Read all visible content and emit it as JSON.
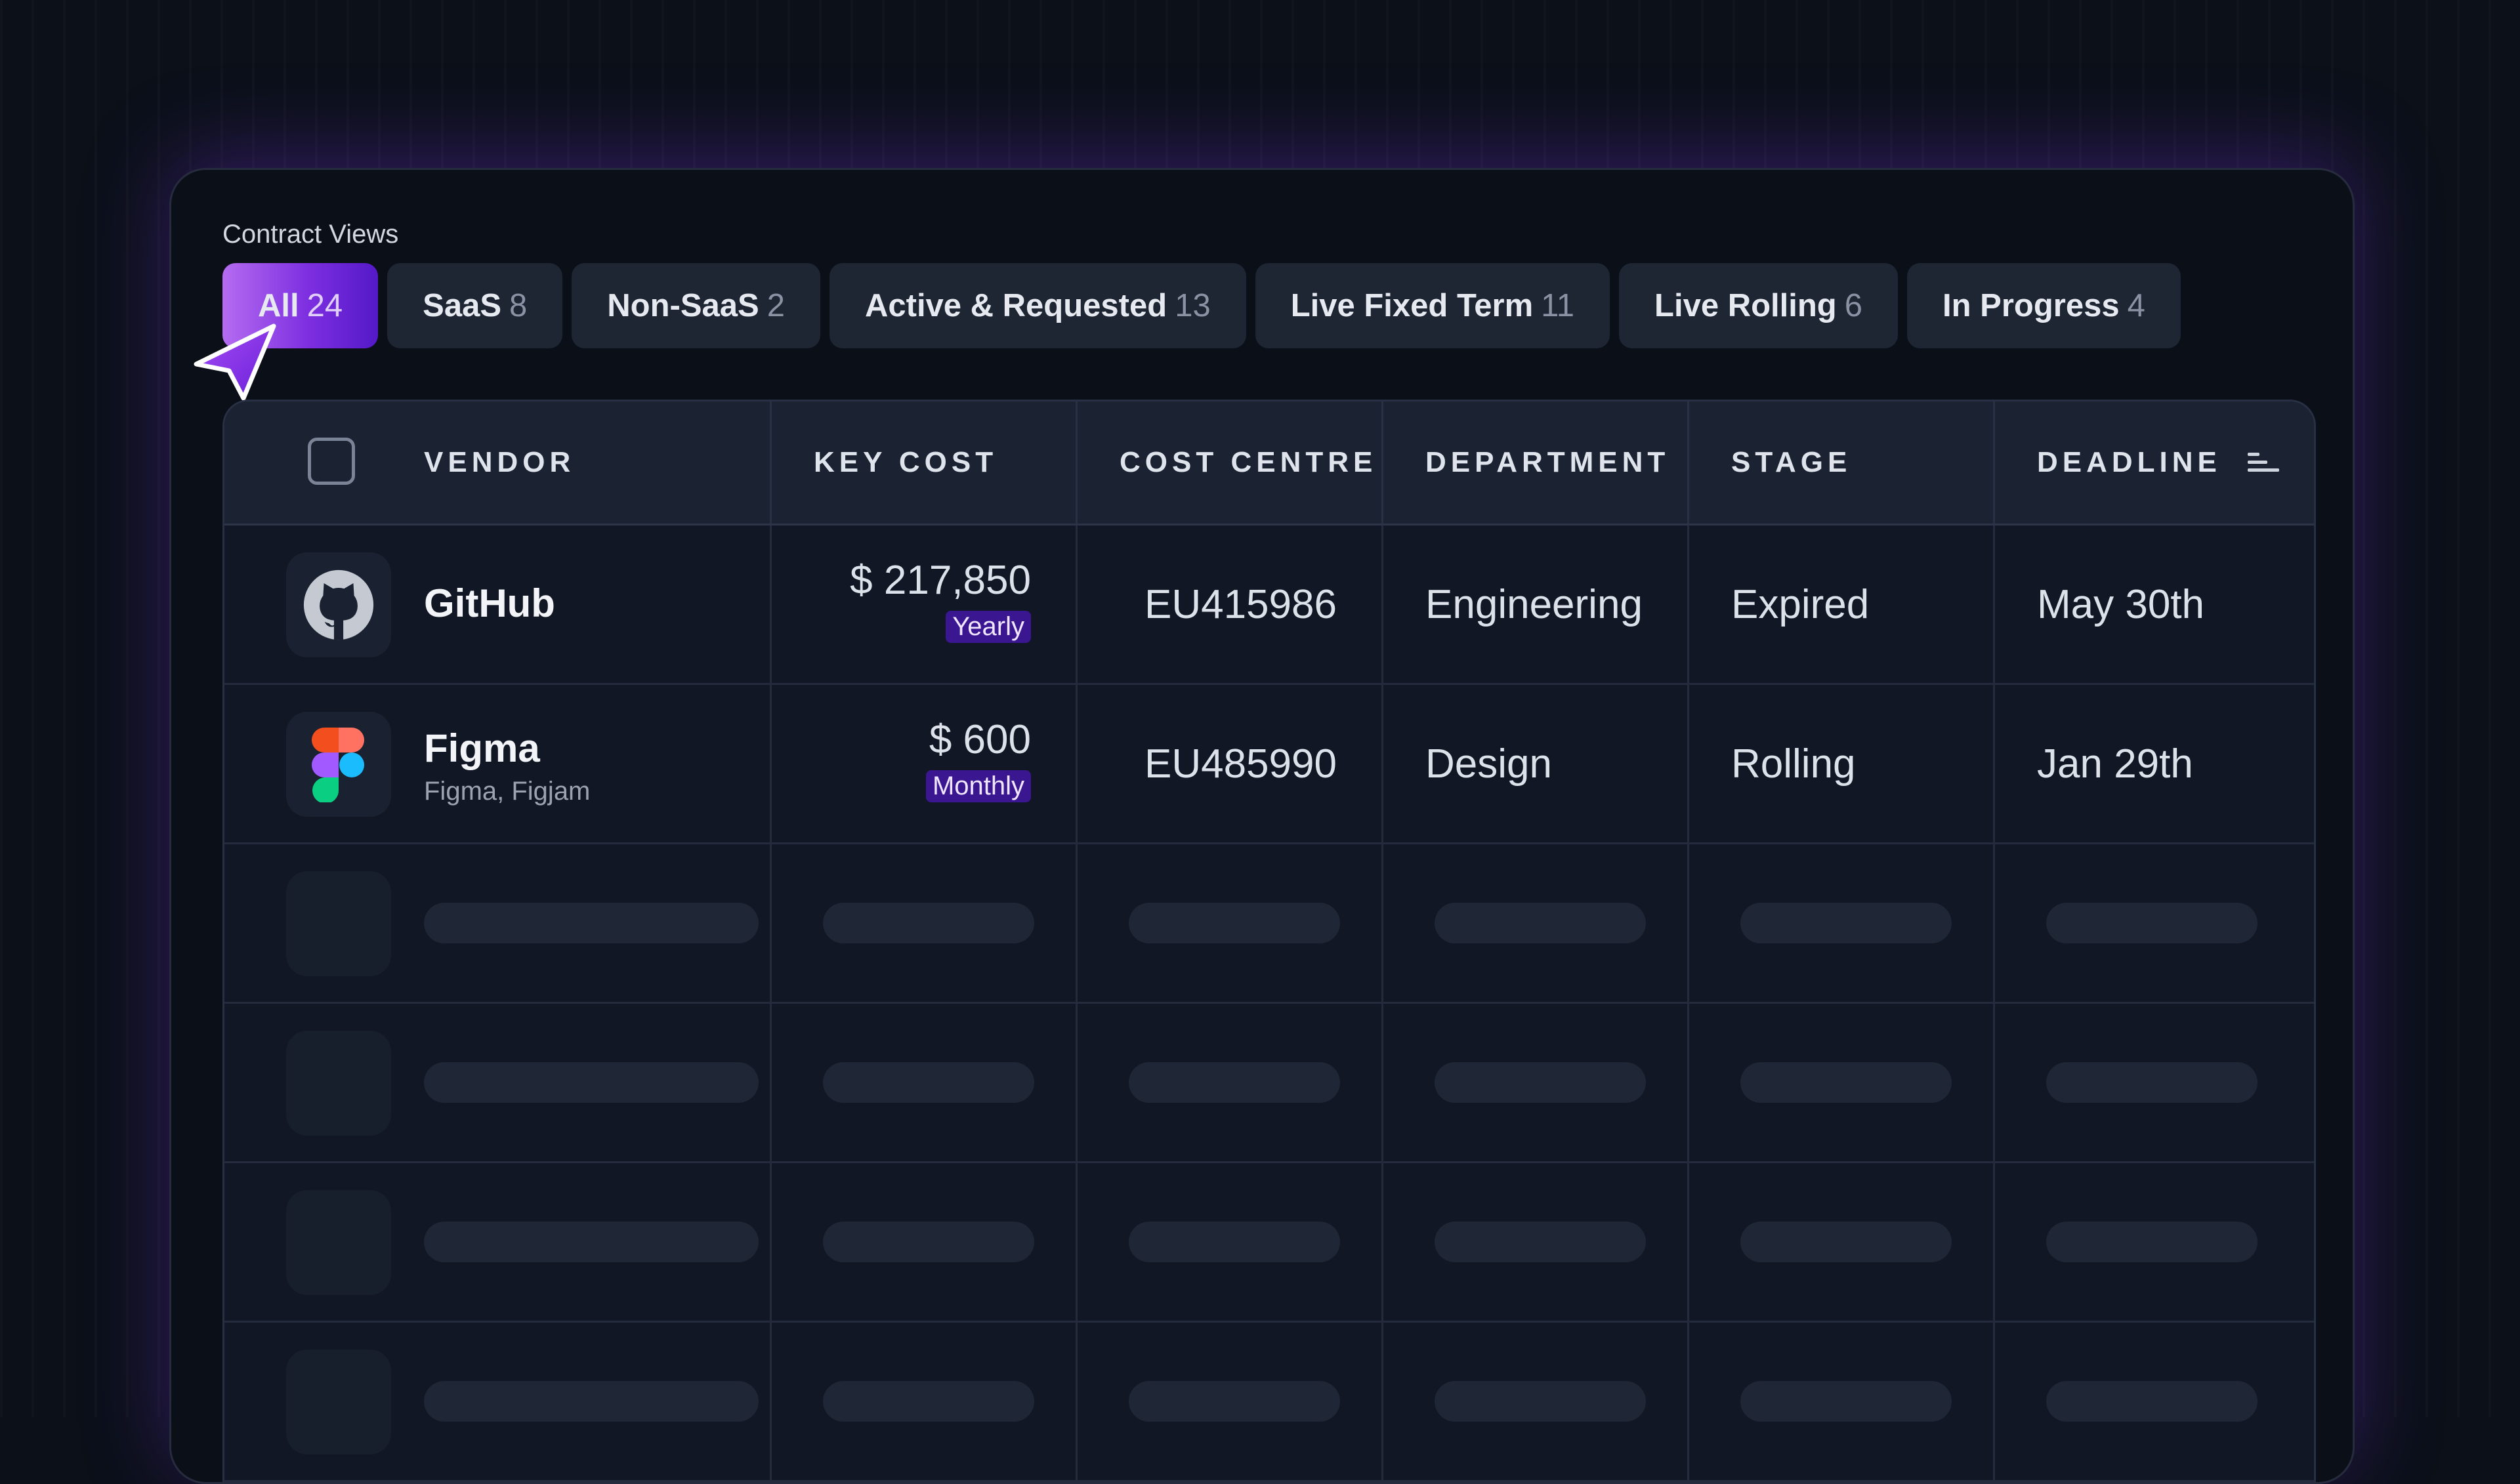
{
  "views": {
    "label": "Contract Views",
    "tabs": [
      {
        "label": "All",
        "count": "24"
      },
      {
        "label": "SaaS",
        "count": "8"
      },
      {
        "label": "Non-SaaS",
        "count": "2"
      },
      {
        "label": "Active & Requested",
        "count": "13"
      },
      {
        "label": "Live Fixed Term",
        "count": "11"
      },
      {
        "label": "Live Rolling",
        "count": "6"
      },
      {
        "label": "In Progress",
        "count": "4"
      }
    ],
    "active_tab": "All"
  },
  "table": {
    "columns": [
      "VENDOR",
      "KEY COST",
      "COST CENTRE",
      "DEPARTMENT",
      "STAGE",
      "DEADLINE"
    ],
    "rows": [
      {
        "vendor": "GitHub",
        "subtitle": "",
        "logo": "github-icon",
        "cost": "$ 217,850",
        "period": "Yearly",
        "cost_centre": "EU415986",
        "department": "Engineering",
        "stage": "Expired",
        "deadline": "May 30th"
      },
      {
        "vendor": "Figma",
        "subtitle": "Figma, Figjam",
        "logo": "figma-icon",
        "cost": "$ 600",
        "period": "Monthly",
        "cost_centre": "EU485990",
        "department": "Design",
        "stage": "Rolling",
        "deadline": "Jan 29th"
      }
    ]
  },
  "colors": {
    "accent": "#7d2fe0",
    "badge_bg": "#3b1691",
    "panel_bg": "#0b0f18",
    "header_bg": "#1b2232"
  }
}
